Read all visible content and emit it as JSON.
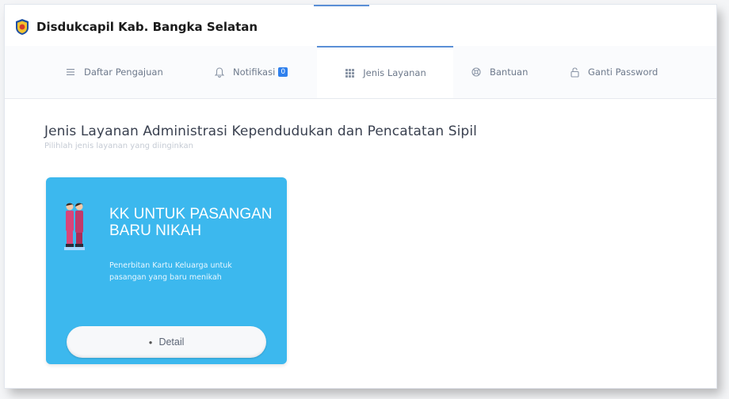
{
  "app": {
    "title": "Disdukcapil Kab. Bangka Selatan"
  },
  "nav": {
    "items": [
      {
        "label": "Daftar Pengajuan",
        "icon": "list-icon"
      },
      {
        "label": "Notifikasi",
        "icon": "bell-icon",
        "badge": "0"
      },
      {
        "label": "Jenis Layanan",
        "icon": "grid-icon",
        "active": true
      },
      {
        "label": "Bantuan",
        "icon": "help-icon"
      },
      {
        "label": "Ganti Password",
        "icon": "lock-icon"
      }
    ]
  },
  "page": {
    "title": "Jenis Layanan Administrasi Kependudukan dan Pencatatan Sipil",
    "subtitle": "Pilihlah jenis layanan yang diinginkan"
  },
  "card": {
    "title": "KK UNTUK PASANGAN BARU NIKAH",
    "description": "Penerbitan Kartu Keluarga untuk pasangan yang baru menikah",
    "button_label": "Detail",
    "color": "#3cb8ee"
  },
  "colors": {
    "accent": "#2f80ed",
    "nav_text": "#6e7a8c"
  }
}
